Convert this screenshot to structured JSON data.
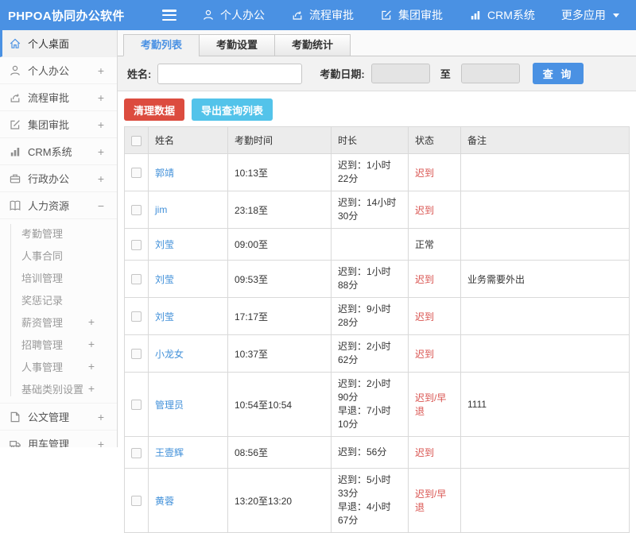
{
  "header": {
    "brand": "PHPOA协同办公软件",
    "nav_items": [
      {
        "key": "personal-office",
        "label": "个人办公",
        "icon": "person-icon"
      },
      {
        "key": "workflow-approval",
        "label": "流程审批",
        "icon": "process-icon"
      },
      {
        "key": "group-approval",
        "label": "集团审批",
        "icon": "edit-icon"
      },
      {
        "key": "crm-system",
        "label": "CRM系统",
        "icon": "chart-icon"
      },
      {
        "key": "more-apps",
        "label": "更多应用",
        "icon": null,
        "caret": true
      }
    ]
  },
  "sidebar": {
    "items": [
      {
        "key": "personal-desktop",
        "label": "个人桌面",
        "icon": "home-icon",
        "expand": "",
        "active": true
      },
      {
        "key": "personal-office",
        "label": "个人办公",
        "icon": "person-icon",
        "expand": "+"
      },
      {
        "key": "workflow-approval",
        "label": "流程审批",
        "icon": "process-icon",
        "expand": "+"
      },
      {
        "key": "group-approval",
        "label": "集团审批",
        "icon": "edit-icon",
        "expand": "+"
      },
      {
        "key": "crm-system",
        "label": "CRM系统",
        "icon": "chart-icon",
        "expand": "+"
      },
      {
        "key": "admin-office",
        "label": "行政办公",
        "icon": "briefcase-icon",
        "expand": "+"
      },
      {
        "key": "human-resources",
        "label": "人力资源",
        "icon": "book-icon",
        "expand": "−",
        "children": [
          {
            "key": "attendance-mgmt",
            "label": "考勤管理",
            "expand": ""
          },
          {
            "key": "hr-contract",
            "label": "人事合同",
            "expand": ""
          },
          {
            "key": "training-mgmt",
            "label": "培训管理",
            "expand": ""
          },
          {
            "key": "reward-punish-records",
            "label": "奖惩记录",
            "expand": ""
          },
          {
            "key": "salary-mgmt",
            "label": "薪资管理",
            "expand": "+"
          },
          {
            "key": "recruit-mgmt",
            "label": "招聘管理",
            "expand": "+"
          },
          {
            "key": "personnel-mgmt",
            "label": "人事管理",
            "expand": "+"
          },
          {
            "key": "base-category-settings",
            "label": "基础类别设置",
            "expand": "+"
          }
        ]
      },
      {
        "key": "document-mgmt",
        "label": "公文管理",
        "icon": "document-icon",
        "expand": "+"
      },
      {
        "key": "vehicle-mgmt",
        "label": "用车管理",
        "icon": "truck-icon",
        "expand": "+"
      }
    ]
  },
  "tabs": [
    {
      "key": "attendance-list",
      "label": "考勤列表",
      "active": true
    },
    {
      "key": "attendance-settings",
      "label": "考勤设置",
      "active": false
    },
    {
      "key": "attendance-stats",
      "label": "考勤统计",
      "active": false
    }
  ],
  "search": {
    "name_label": "姓名:",
    "name_value": "",
    "date_label": "考勤日期:",
    "date_from_value": "",
    "to_label": "至",
    "date_to_value": "",
    "query_button": "查 询"
  },
  "toolbar": {
    "clean_button": "清理数据",
    "export_button": "导出查询列表"
  },
  "table": {
    "columns": [
      "姓名",
      "考勤时间",
      "时长",
      "状态",
      "备注"
    ],
    "rows": [
      {
        "name": "郭靖",
        "time": "10:13至",
        "duration": [
          "迟到：1小时22分"
        ],
        "status": "迟到",
        "status_type": "late",
        "note": ""
      },
      {
        "name": "jim",
        "time": "23:18至",
        "duration": [
          "迟到：14小时30分"
        ],
        "status": "迟到",
        "status_type": "late",
        "note": ""
      },
      {
        "name": "刘莹",
        "time": "09:00至",
        "duration": [],
        "status": "正常",
        "status_type": "normal",
        "note": ""
      },
      {
        "name": "刘莹",
        "time": "09:53至",
        "duration": [
          "迟到：1小时88分"
        ],
        "status": "迟到",
        "status_type": "late",
        "note": "业务需要外出"
      },
      {
        "name": "刘莹",
        "time": "17:17至",
        "duration": [
          "迟到：9小时28分"
        ],
        "status": "迟到",
        "status_type": "late",
        "note": ""
      },
      {
        "name": "小龙女",
        "time": "10:37至",
        "duration": [
          "迟到：2小时62分"
        ],
        "status": "迟到",
        "status_type": "late",
        "note": ""
      },
      {
        "name": "管理员",
        "time": "10:54至10:54",
        "duration": [
          "迟到：2小时90分",
          "早退：7小时10分"
        ],
        "status": "迟到/早退",
        "status_type": "late",
        "note": "1111"
      },
      {
        "name": "王壹辉",
        "time": "08:56至",
        "duration": [
          "迟到：56分"
        ],
        "status": "迟到",
        "status_type": "late",
        "note": ""
      },
      {
        "name": "黄蓉",
        "time": "13:20至13:20",
        "duration": [
          "迟到：5小时33分",
          "早退：4小时67分"
        ],
        "status": "迟到/早退",
        "status_type": "late",
        "note": ""
      }
    ]
  },
  "colors": {
    "header_bg": "#4a91e3",
    "accent_blue": "#4a91e3",
    "link_blue": "#4190d9",
    "status_red": "#d9534f",
    "clean_button_red": "#dc4c3f",
    "export_button_teal": "#53c3ea"
  }
}
